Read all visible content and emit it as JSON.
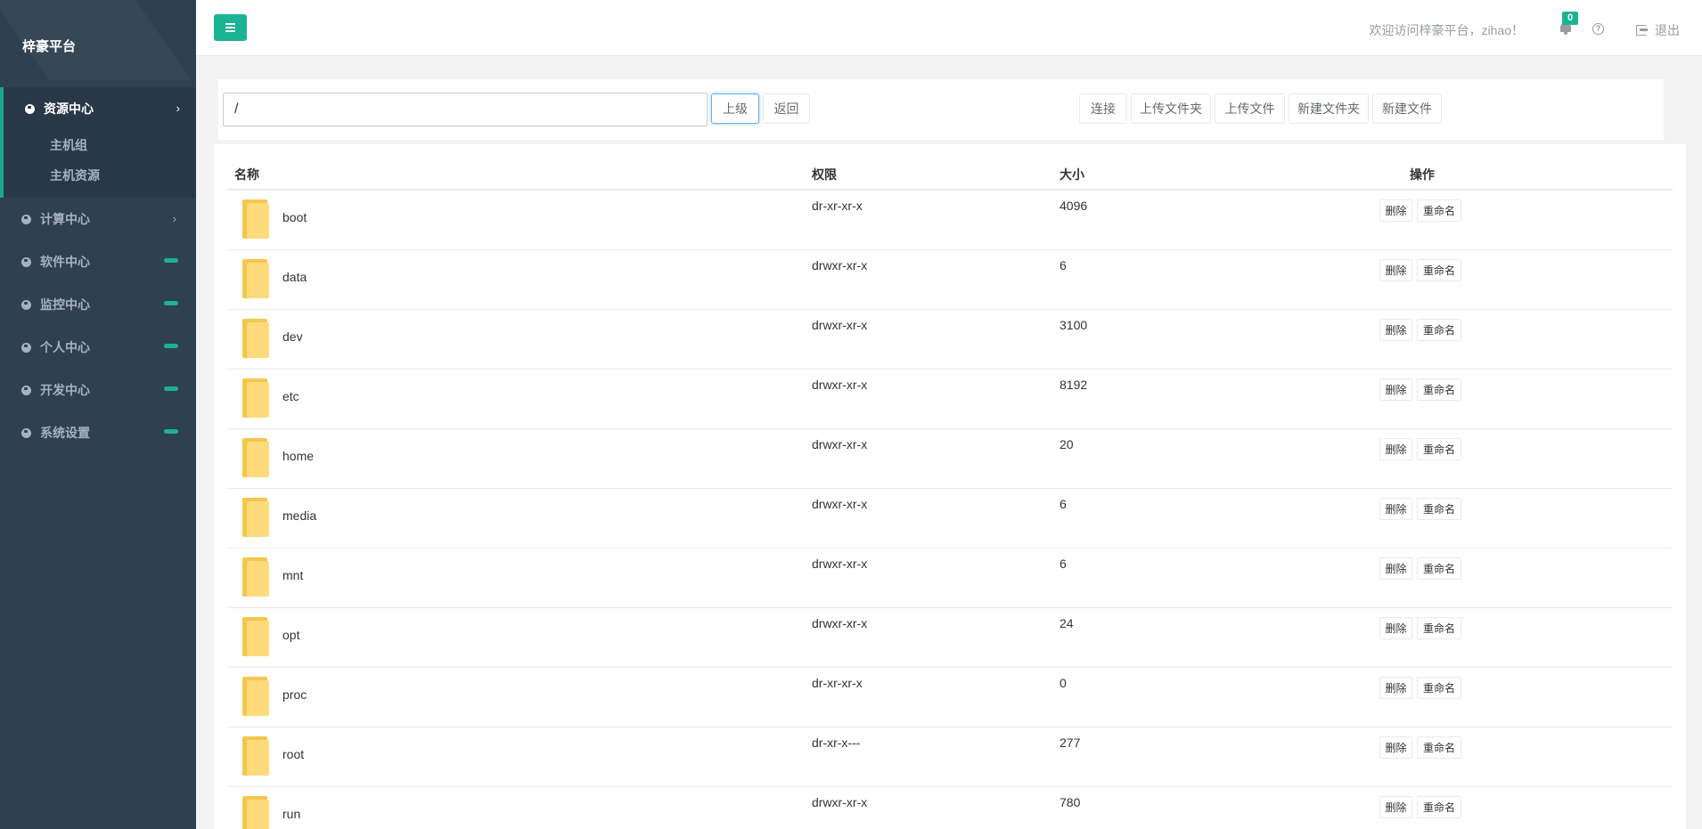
{
  "sidebar": {
    "brand": "梓豪平台",
    "active_group": {
      "label": "资源中心",
      "children": [
        "主机组",
        "主机资源"
      ]
    },
    "items": [
      {
        "label": "计算中心",
        "indicator": "arrow"
      },
      {
        "label": "软件中心",
        "indicator": "bar"
      },
      {
        "label": "监控中心",
        "indicator": "bar"
      },
      {
        "label": "个人中心",
        "indicator": "bar"
      },
      {
        "label": "开发中心",
        "indicator": "bar"
      },
      {
        "label": "系统设置",
        "indicator": "bar"
      }
    ]
  },
  "topbar": {
    "welcome": "欢迎访问梓豪平台，zihao！",
    "notification_count": "0",
    "logout_label": "退出"
  },
  "path_bar": {
    "path": "/",
    "up_label": "上级",
    "back_label": "返回"
  },
  "toolbar": {
    "buttons": [
      "连接",
      "上传文件夹",
      "上传文件",
      "新建文件夹",
      "新建文件"
    ]
  },
  "table": {
    "headers": {
      "name": "名称",
      "perm": "权限",
      "size": "大小",
      "actions": "操作"
    },
    "action_labels": {
      "delete": "删除",
      "rename": "重命名"
    },
    "rows": [
      {
        "name": "boot",
        "perm": "dr-xr-xr-x",
        "size": "4096"
      },
      {
        "name": "data",
        "perm": "drwxr-xr-x",
        "size": "6"
      },
      {
        "name": "dev",
        "perm": "drwxr-xr-x",
        "size": "3100"
      },
      {
        "name": "etc",
        "perm": "drwxr-xr-x",
        "size": "8192"
      },
      {
        "name": "home",
        "perm": "drwxr-xr-x",
        "size": "20"
      },
      {
        "name": "media",
        "perm": "drwxr-xr-x",
        "size": "6"
      },
      {
        "name": "mnt",
        "perm": "drwxr-xr-x",
        "size": "6"
      },
      {
        "name": "opt",
        "perm": "drwxr-xr-x",
        "size": "24"
      },
      {
        "name": "proc",
        "perm": "dr-xr-xr-x",
        "size": "0"
      },
      {
        "name": "root",
        "perm": "dr-xr-x---",
        "size": "277"
      },
      {
        "name": "run",
        "perm": "drwxr-xr-x",
        "size": "780"
      }
    ]
  },
  "colors": {
    "sidebar_bg": "#2f4050",
    "accent": "#1ab394",
    "folder": "#fddb7a"
  }
}
